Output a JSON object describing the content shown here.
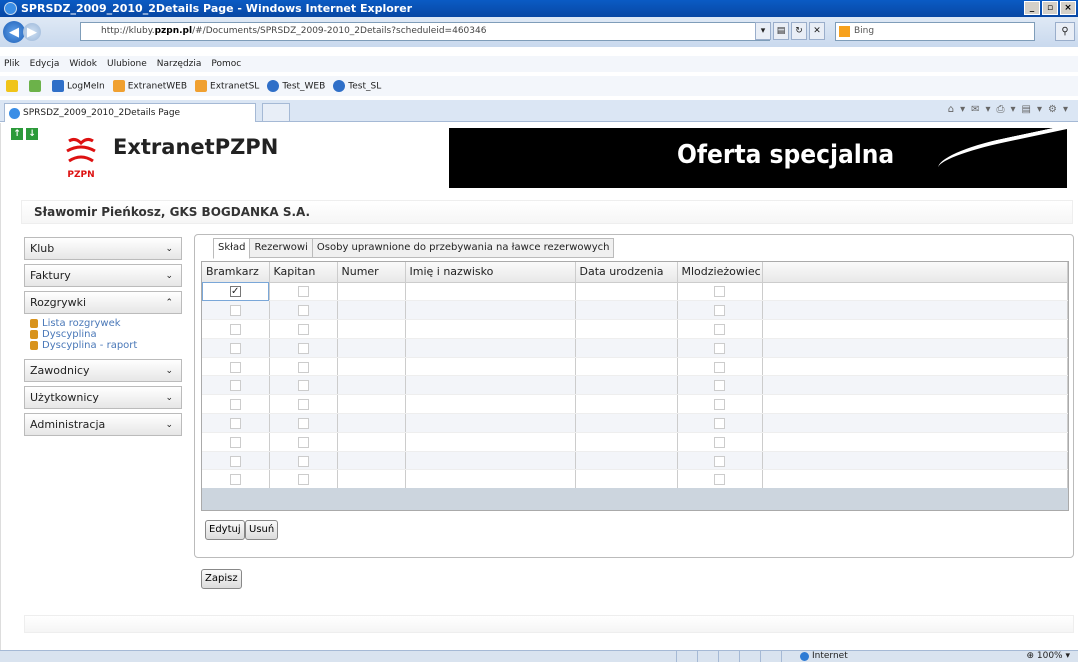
{
  "window": {
    "title": "SPRSDZ_2009_2010_2Details Page - Windows Internet Explorer"
  },
  "address": {
    "prefix": "http://kluby.",
    "host": "pzpn.pl",
    "suffix": "/#/Documents/SPRSDZ_2009-2010_2Details?scheduleid=460346"
  },
  "search": {
    "placeholder": "Bing"
  },
  "menu": [
    "Plik",
    "Edycja",
    "Widok",
    "Ulubione",
    "Narzędzia",
    "Pomoc"
  ],
  "favorites": [
    "LogMeIn",
    "ExtranetWEB",
    "ExtranetSL",
    "Test_WEB",
    "Test_SL"
  ],
  "browser_tab": {
    "label": "SPRSDZ_2009_2010_2Details Page"
  },
  "header": {
    "brand": "ExtranetPZPN",
    "logo_text": "PZPN",
    "banner_text": "Oferta specjalna"
  },
  "user_line": "Sławomir Pieńkosz, GKS BOGDANKA S.A.",
  "sidebar": {
    "items": [
      {
        "label": "Klub",
        "expanded": false
      },
      {
        "label": "Faktury",
        "expanded": false
      },
      {
        "label": "Rozgrywki",
        "expanded": true
      },
      {
        "label": "Zawodnicy",
        "expanded": false
      },
      {
        "label": "Użytkownicy",
        "expanded": false
      },
      {
        "label": "Administracja",
        "expanded": false
      }
    ],
    "rozgrywki_links": [
      "Lista rozgrywek",
      "Dyscyplina",
      "Dyscyplina - raport"
    ]
  },
  "content_tabs": [
    "Skład",
    "Rezerwowi",
    "Osoby uprawnione do przebywania na ławce rezerwowych"
  ],
  "grid": {
    "columns": [
      "Bramkarz",
      "Kapitan",
      "Numer",
      "Imię i nazwisko",
      "Data urodzenia",
      "Mlodzieżowiec"
    ],
    "row_count": 11,
    "rows": [
      {
        "bramkarz": true,
        "kapitan": false,
        "mlodziezowiec": false
      },
      {
        "bramkarz": false,
        "kapitan": false,
        "mlodziezowiec": false
      },
      {
        "bramkarz": false,
        "kapitan": false,
        "mlodziezowiec": false
      },
      {
        "bramkarz": false,
        "kapitan": false,
        "mlodziezowiec": false
      },
      {
        "bramkarz": false,
        "kapitan": false,
        "mlodziezowiec": false
      },
      {
        "bramkarz": false,
        "kapitan": false,
        "mlodziezowiec": false
      },
      {
        "bramkarz": false,
        "kapitan": false,
        "mlodziezowiec": false
      },
      {
        "bramkarz": false,
        "kapitan": false,
        "mlodziezowiec": false
      },
      {
        "bramkarz": false,
        "kapitan": false,
        "mlodziezowiec": false
      },
      {
        "bramkarz": false,
        "kapitan": false,
        "mlodziezowiec": false
      },
      {
        "bramkarz": false,
        "kapitan": false,
        "mlodziezowiec": false
      }
    ]
  },
  "buttons": {
    "edit": "Edytuj",
    "delete": "Usuń",
    "save": "Zapisz"
  },
  "statusbar": {
    "zone": "Internet",
    "zoom": "100%"
  }
}
